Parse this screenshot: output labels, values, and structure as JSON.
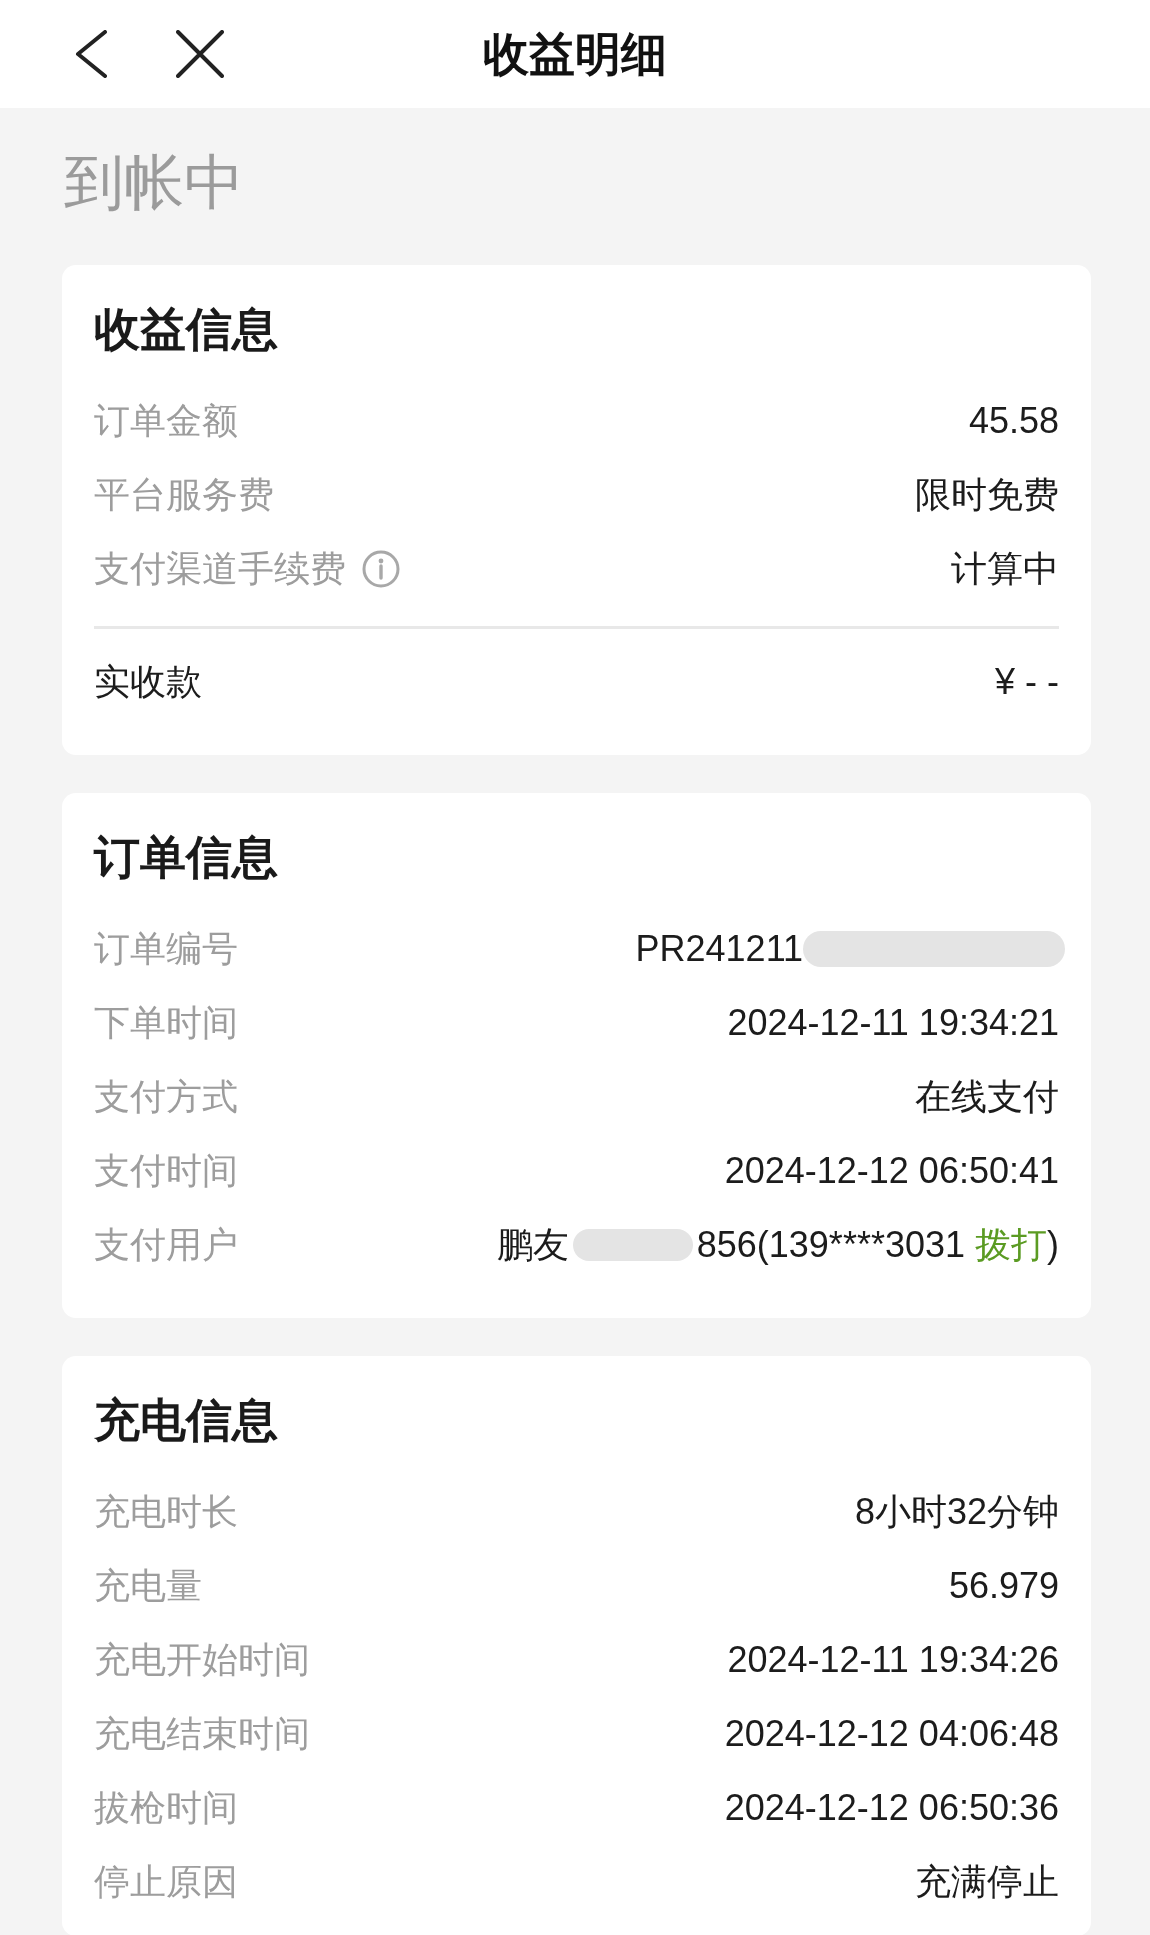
{
  "header": {
    "title": "收益明细"
  },
  "status": "到帐中",
  "sections": [
    {
      "title": "收益信息",
      "rows": [
        {
          "kind": "text",
          "label": "订单金额",
          "value": "45.58",
          "info": false
        },
        {
          "kind": "text",
          "label": "平台服务费",
          "value": "限时免费",
          "info": false
        },
        {
          "kind": "text",
          "label": "支付渠道手续费",
          "value": "计算中",
          "info": true
        }
      ],
      "total": {
        "label": "实收款",
        "value": "¥ - -"
      }
    },
    {
      "title": "订单信息",
      "rows": [
        {
          "kind": "redacted",
          "label": "订单编号",
          "value": "PR241211"
        },
        {
          "kind": "text",
          "label": "下单时间",
          "value": "2024-12-11 19:34:21"
        },
        {
          "kind": "text",
          "label": "支付方式",
          "value": "在线支付"
        },
        {
          "kind": "text",
          "label": "支付时间",
          "value": "2024-12-12 06:50:41"
        },
        {
          "kind": "contact",
          "label": "支付用户",
          "name": "鹏友",
          "value": "856(139****3031",
          "link": "拨打",
          "tail": ")"
        }
      ]
    },
    {
      "title": "充电信息",
      "rows": [
        {
          "kind": "text",
          "label": "充电时长",
          "value": "8小时32分钟"
        },
        {
          "kind": "text",
          "label": "充电量",
          "value": "56.979"
        },
        {
          "kind": "text",
          "label": "充电开始时间",
          "value": "2024-12-11 19:34:26"
        },
        {
          "kind": "text",
          "label": "充电结束时间",
          "value": "2024-12-12 04:06:48"
        },
        {
          "kind": "text",
          "label": "拔枪时间",
          "value": "2024-12-12 06:50:36"
        },
        {
          "kind": "text",
          "label": "停止原因",
          "value": "充满停止"
        }
      ]
    }
  ]
}
